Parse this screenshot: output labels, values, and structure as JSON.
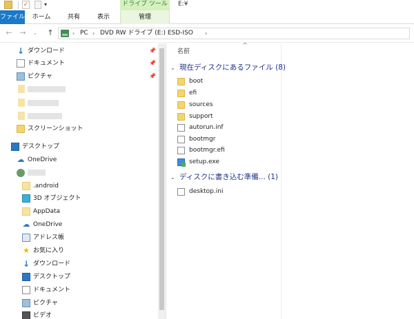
{
  "titlebar": {
    "drive_tools": "ドライブ ツール",
    "title": "E:¥",
    "qat_check": "✓",
    "qat_dropdown": "▾"
  },
  "ribbon": {
    "tabs": [
      {
        "label": "ファイル"
      },
      {
        "label": "ホーム"
      },
      {
        "label": "共有"
      },
      {
        "label": "表示"
      },
      {
        "label": "管理"
      }
    ]
  },
  "nav": {
    "back": "←",
    "forward": "→",
    "recent": "⌄",
    "up": "↑"
  },
  "address": {
    "crumbs": [
      "PC",
      "DVD RW ドライブ (E:) ESD-ISO"
    ],
    "sep": "›"
  },
  "sidebar": {
    "pin": "📌",
    "items": [
      {
        "label": "ダウンロード"
      },
      {
        "label": "ドキュメント"
      },
      {
        "label": "ピクチャ"
      },
      {
        "label": "スクリーンショット"
      },
      {
        "label": "デスクトップ"
      },
      {
        "label": "OneDrive"
      },
      {
        "label": ".android"
      },
      {
        "label": "3D オブジェクト"
      },
      {
        "label": "AppData"
      },
      {
        "label": "OneDrive"
      },
      {
        "label": "アドレス帳"
      },
      {
        "label": "お気に入り"
      },
      {
        "label": "ダウンロード"
      },
      {
        "label": "デスクトップ"
      },
      {
        "label": "ドキュメント"
      },
      {
        "label": "ピクチャ"
      },
      {
        "label": "ビデオ"
      }
    ]
  },
  "main": {
    "column_name": "名前",
    "sort_indicator": "^",
    "chevron": "⌄",
    "groups": [
      {
        "title": "現在ディスクにあるファイル (8)",
        "files": [
          {
            "name": "boot",
            "icon": "folder-icon"
          },
          {
            "name": "efi",
            "icon": "folder-icon"
          },
          {
            "name": "sources",
            "icon": "folder-icon"
          },
          {
            "name": "support",
            "icon": "folder-icon"
          },
          {
            "name": "autorun.inf",
            "icon": "settings-file-icon"
          },
          {
            "name": "bootmgr",
            "icon": "file-icon"
          },
          {
            "name": "bootmgr.efi",
            "icon": "file-icon"
          },
          {
            "name": "setup.exe",
            "icon": "setup-icon"
          }
        ]
      },
      {
        "title": "ディスクに書き込む準備... (1)",
        "files": [
          {
            "name": "desktop.ini",
            "icon": "settings-file-icon"
          }
        ]
      }
    ]
  }
}
